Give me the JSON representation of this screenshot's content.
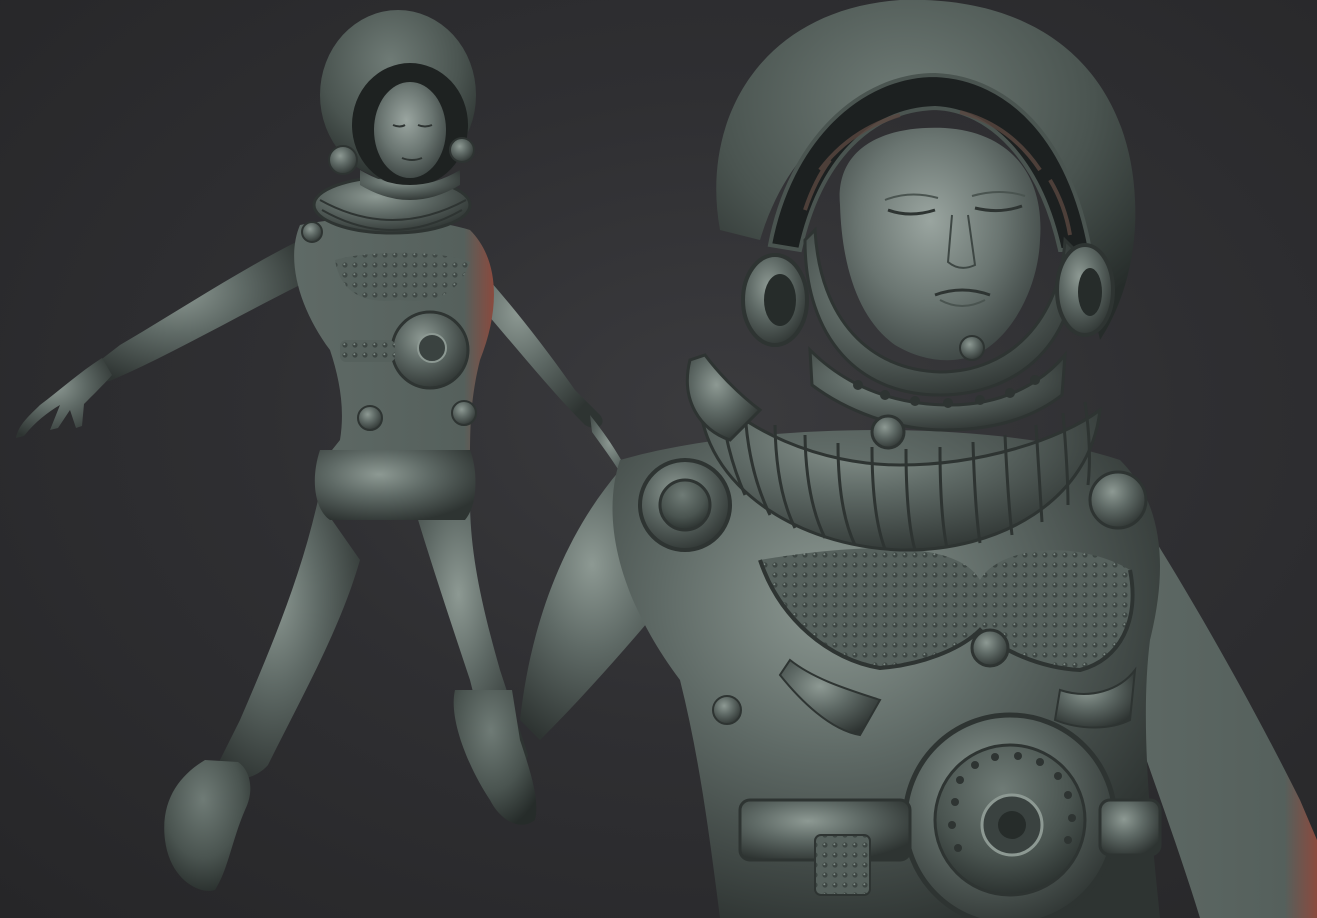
{
  "scene": {
    "background_color": "#2d2d30",
    "clay_color": "#5f6a66",
    "clay_highlight": "#8d9993",
    "clay_shadow": "#2e3432",
    "rim_light_color": "#8a4a3e",
    "figures": [
      {
        "name": "full-body-view",
        "description_icon": "astronaut-figure"
      },
      {
        "name": "close-up-view",
        "description_icon": "astronaut-bust"
      }
    ]
  }
}
